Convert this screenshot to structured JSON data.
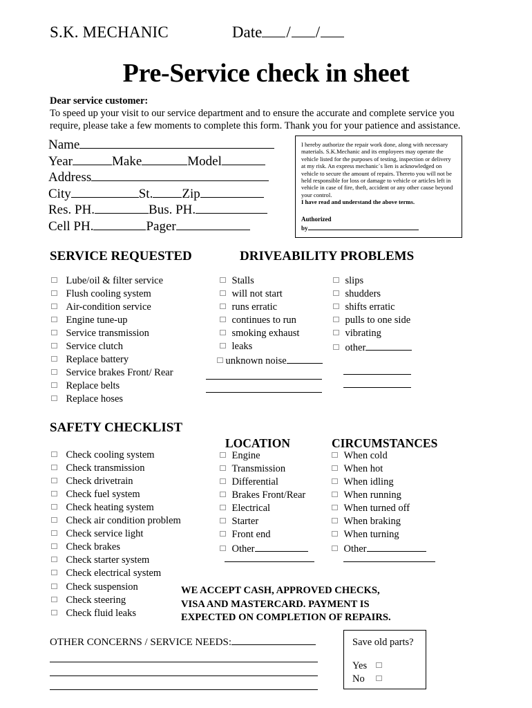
{
  "header": {
    "brand": "S.K. MECHANIC",
    "date_label": "Date",
    "date_slash": "/",
    "title": "Pre-Service check in sheet"
  },
  "intro": {
    "salutation": "Dear service customer:",
    "body": "To speed up your visit to our service department and to ensure the accurate and complete service you require, please take a few moments to complete this form. Thank you for your patience and assistance."
  },
  "customer_fields": {
    "name": "Name",
    "year": "Year",
    "make": "Make",
    "model": "Model",
    "address": "Address",
    "city": "City",
    "state": "St.",
    "zip": "Zip",
    "res_ph": "Res. PH.",
    "bus_ph": "Bus. PH.",
    "cell_ph": "Cell PH.",
    "pager": "Pager"
  },
  "legal": {
    "body": "I hereby authorize the repair work done, along with necessary materials. S.K.Mechanic and its employees may operate the vehicle listed for the purposes of testing, inspection or delivery at my risk. An express mechanic`s lien is acknowledged on vehicle to secure the amount of repairs. Thereto you will not be held responsible for loss or damage to vehicle or articles left in vehicle in case of fire, theft, accident or any other cause beyond your control.",
    "acknowledge": "I have read and understand the above terms.",
    "authorized_label": "Authorized",
    "by_label": "by"
  },
  "sections": {
    "service_requested": {
      "heading": "SERVICE REQUESTED",
      "items": [
        "Lube/oil & filter service",
        "Flush cooling system",
        "Air-condition service",
        "Engine tune-up",
        "Service transmission",
        "Service clutch",
        "Replace battery",
        "Service brakes  Front/ Rear",
        "Replace belts",
        "Replace hoses"
      ]
    },
    "driveability_problems": {
      "heading": "DRIVEABILITY PROBLEMS",
      "column1": [
        "Stalls",
        "will not start",
        "runs erratic",
        "continues to run",
        "smoking exhaust",
        "leaks",
        "unknown noise"
      ],
      "column2": [
        "slips",
        "shudders",
        "shifts erratic",
        "pulls to one side",
        "vibrating",
        "other"
      ]
    },
    "safety_checklist": {
      "heading": "SAFETY CHECKLIST",
      "items": [
        "Check cooling system",
        "Check transmission",
        "Check drivetrain",
        "Check fuel system",
        "Check heating system",
        "Check air condition problem",
        "Check service light",
        "Check brakes",
        "Check starter system",
        "Check electrical system",
        "Check suspension",
        "Check steering",
        "Check fluid leaks"
      ]
    },
    "location": {
      "heading": "LOCATION",
      "items": [
        "Engine",
        "Transmission",
        "Differential",
        "Brakes  Front/Rear",
        "Electrical",
        "Starter",
        "Front end",
        "Other"
      ]
    },
    "circumstances": {
      "heading": "CIRCUMSTANCES",
      "items": [
        "When cold",
        "When hot",
        "When idling",
        "When running",
        "When turned off",
        "When braking",
        "When turning",
        "Other"
      ]
    }
  },
  "payment_notice": {
    "line1": "WE ACCEPT CASH, APPROVED CHECKS,",
    "line2": "VISA AND MASTERCARD.  PAYMENT IS",
    "line3": "EXPECTED ON COMPLETION OF REPAIRS."
  },
  "other_concerns": {
    "label": "OTHER CONCERNS / SERVICE NEEDS:"
  },
  "save_old_parts": {
    "question": "Save old parts?",
    "yes": "Yes",
    "no": "No"
  },
  "colors": {
    "ink": "#000000",
    "paper": "#ffffff",
    "checkbox_border": "#999999"
  }
}
